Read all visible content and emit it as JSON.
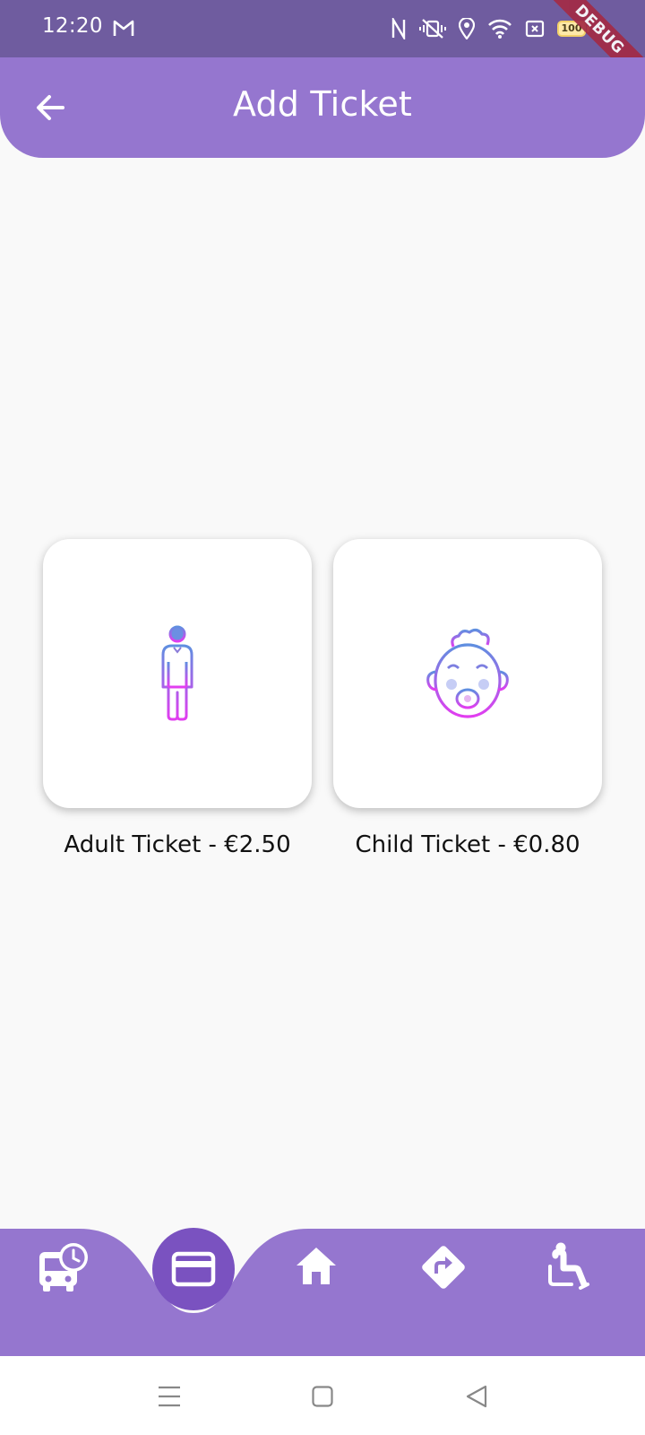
{
  "status_bar": {
    "time": "12:20",
    "battery_level": "100",
    "icons": [
      "gmail-icon",
      "nfc-icon",
      "vibrate-icon",
      "location-icon",
      "wifi-icon",
      "sim-off-icon",
      "battery-icon"
    ]
  },
  "debug_banner": {
    "label": "DEBUG"
  },
  "app_bar": {
    "title": "Add Ticket",
    "back_icon": "arrow-back-icon"
  },
  "tickets": [
    {
      "label": "Adult Ticket - €2.50",
      "icon": "adult-person-icon"
    },
    {
      "label": "Child Ticket - €0.80",
      "icon": "baby-face-icon"
    }
  ],
  "bottom_nav": {
    "items": [
      {
        "name": "bus-schedule",
        "icon": "bus-clock-icon"
      },
      {
        "name": "tickets",
        "icon": "credit-card-icon",
        "active": true
      },
      {
        "name": "home",
        "icon": "home-icon"
      },
      {
        "name": "directions",
        "icon": "directions-icon"
      },
      {
        "name": "accessibility",
        "icon": "accessible-seat-icon"
      }
    ]
  },
  "system_nav": {
    "items": [
      "menu-icon",
      "home-square-icon",
      "back-triangle-icon"
    ]
  },
  "colors": {
    "status_bar": "#6f5c9f",
    "app_bar": "#9576cf",
    "nav_bar": "#9576cf",
    "fab": "#7a52c0",
    "background": "#f9f9f9",
    "icon_gradient_start": "#5f8fe0",
    "icon_gradient_end": "#e23df0"
  }
}
